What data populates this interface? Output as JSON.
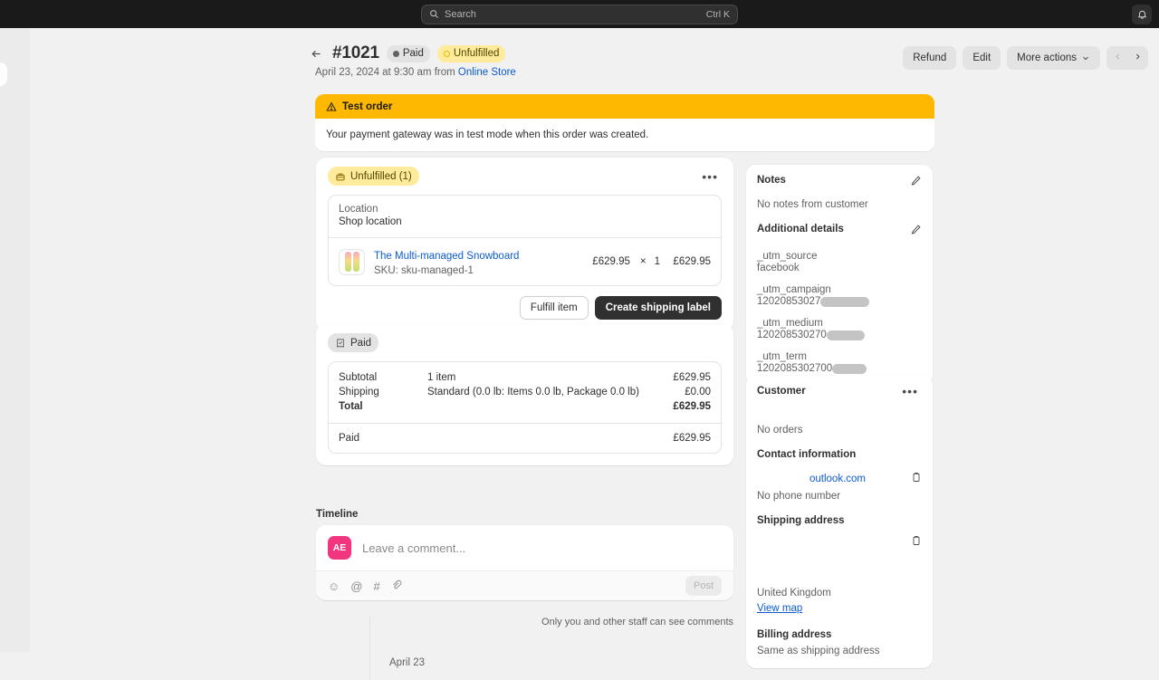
{
  "topbar": {
    "search_placeholder": "Search",
    "search_shortcut": "Ctrl K",
    "search_icon": "search-icon",
    "bell_icon": "bell-icon"
  },
  "order": {
    "back_icon": "arrow-left-icon",
    "number": "#1021",
    "payment_badge": "Paid",
    "fulfillment_badge": "Unfulfilled",
    "date_prefix": "April 23, 2024 at 9:30 am from ",
    "source_link": "Online Store"
  },
  "header_actions": {
    "refund": "Refund",
    "edit": "Edit",
    "more_actions": "More actions",
    "chevron_icon": "chevron-down-icon",
    "prev_icon": "chevron-left-icon",
    "next_icon": "chevron-right-icon"
  },
  "banner": {
    "warning_icon": "warning-triangle-icon",
    "title": "Test order",
    "body": "Your payment gateway was in test mode when this order was created."
  },
  "fulfillment": {
    "badge_icon": "package-icon",
    "badge_label": "Unfulfilled (1)",
    "kebab_icon": "ellipsis-icon",
    "location_label": "Location",
    "location_value": "Shop location",
    "item": {
      "thumbnail_icon": "snowboard-thumbnail",
      "title": "The Multi-managed Snowboard",
      "sku": "SKU: sku-managed-1",
      "unit_price": "£629.95",
      "times": "×",
      "quantity": "1",
      "line_total": "£629.95"
    },
    "fulfill_item_button": "Fulfill item",
    "create_label_button": "Create shipping label"
  },
  "payment": {
    "badge_icon": "receipt-check-icon",
    "badge_label": "Paid",
    "rows": [
      {
        "label": "Subtotal",
        "desc": "1 item",
        "amount": "£629.95",
        "bold": false
      },
      {
        "label": "Shipping",
        "desc": "Standard (0.0 lb: Items 0.0 lb, Package 0.0 lb)",
        "amount": "£0.00",
        "bold": false
      },
      {
        "label": "Total",
        "desc": "",
        "amount": "£629.95",
        "bold": true
      }
    ],
    "paid_label": "Paid",
    "paid_amount": "£629.95"
  },
  "timeline": {
    "title": "Timeline",
    "avatar_initials": "AE",
    "comment_placeholder": "Leave a comment...",
    "toolbar_icons": [
      "emoji-icon",
      "mention-icon",
      "hashtag-icon",
      "attachment-icon"
    ],
    "toolbar_glyphs": [
      "☺",
      "@",
      "#",
      "🔗"
    ],
    "post_button": "Post",
    "staff_note": "Only you and other staff can see comments",
    "date_group": "April 23"
  },
  "notes": {
    "title": "Notes",
    "edit_icon": "pencil-icon",
    "empty_text": "No notes from customer"
  },
  "additional_details": {
    "title": "Additional details",
    "edit_icon": "pencil-icon",
    "entries": [
      {
        "key": "_utm_source",
        "value": "facebook",
        "redacted_width": 0
      },
      {
        "key": "_utm_campaign",
        "value": "12020853027",
        "redacted_width": 54
      },
      {
        "key": "_utm_medium",
        "value": "120208530270",
        "redacted_width": 42
      },
      {
        "key": "_utm_term",
        "value": "1202085302700",
        "redacted_width": 38
      }
    ]
  },
  "customer": {
    "title": "Customer",
    "kebab_icon": "ellipsis-icon",
    "orders_text": "No orders",
    "contact_title": "Contact information",
    "email_visible": "outlook.com",
    "copy_icon": "clipboard-icon",
    "phone_text": "No phone number",
    "shipping_title": "Shipping address",
    "shipping_country": "United Kingdom",
    "view_map": "View map",
    "billing_title": "Billing address",
    "billing_text": "Same as shipping address"
  },
  "colors": {
    "accent_link": "#0c5bd1",
    "warning": "#ffb800",
    "badge_yellow": "#ffeb9b",
    "avatar_pink": "#f2357f",
    "primary_button": "#303030"
  }
}
